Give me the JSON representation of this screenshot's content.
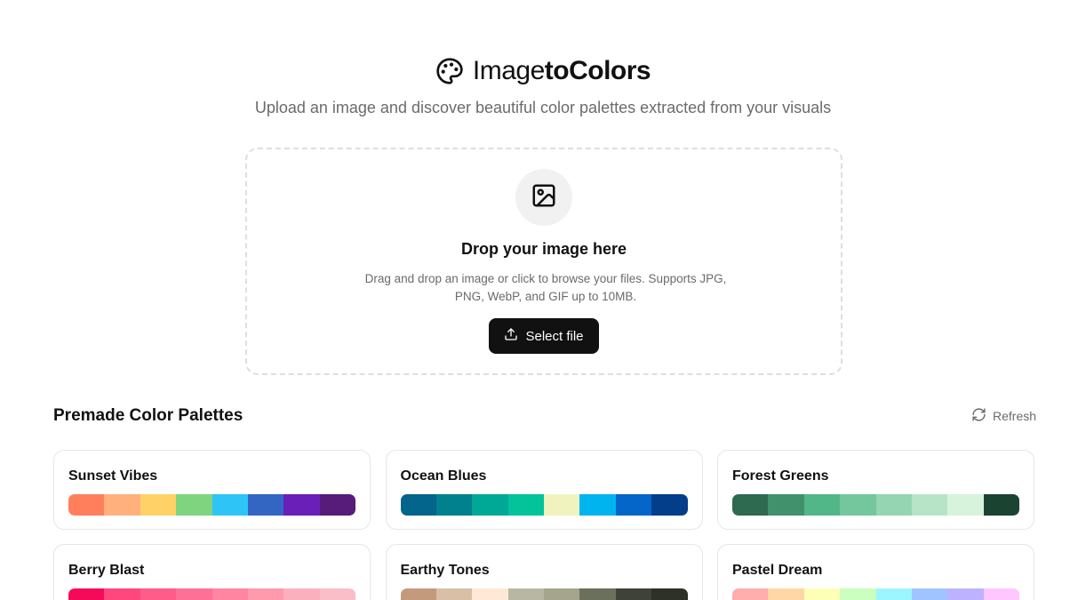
{
  "header": {
    "title_light": "Image",
    "title_bold": "toColors",
    "tagline": "Upload an image and discover beautiful color palettes extracted from your visuals"
  },
  "dropzone": {
    "title": "Drop your image here",
    "description": "Drag and drop an image or click to browse your files. Supports JPG, PNG, WebP, and GIF up to 10MB.",
    "button_label": "Select file"
  },
  "palettes_section": {
    "title": "Premade Color Palettes",
    "refresh_label": "Refresh",
    "palettes": [
      {
        "name": "Sunset Vibes",
        "colors": [
          "#ff7f5c",
          "#ffb07c",
          "#ffd166",
          "#7fd47f",
          "#2ec4f6",
          "#3366c2",
          "#6a1fb8",
          "#571c7a"
        ]
      },
      {
        "name": "Ocean Blues",
        "colors": [
          "#03658c",
          "#01808e",
          "#00a896",
          "#02c39a",
          "#f0f3bd",
          "#00b4f0",
          "#0466c8",
          "#023e8a"
        ]
      },
      {
        "name": "Forest Greens",
        "colors": [
          "#2d6a4f",
          "#40916c",
          "#52b788",
          "#74c69d",
          "#95d5b2",
          "#b7e4c7",
          "#d8f3dc",
          "#1b4332"
        ]
      },
      {
        "name": "Berry Blast",
        "colors": [
          "#f50a5a",
          "#ff477e",
          "#ff5c8a",
          "#ff7096",
          "#ff85a1",
          "#ff99ac",
          "#fbb1bd",
          "#f9bec7"
        ]
      },
      {
        "name": "Earthy Tones",
        "colors": [
          "#c49a7c",
          "#d9bfa6",
          "#ffe8d6",
          "#b7b7a4",
          "#a5a58d",
          "#6b705c",
          "#3f4238",
          "#2d3127"
        ]
      },
      {
        "name": "Pastel Dream",
        "colors": [
          "#ffadad",
          "#ffd6a5",
          "#fdffb6",
          "#caffbf",
          "#9bf6ff",
          "#a0c4ff",
          "#bdb2ff",
          "#ffc6ff"
        ]
      }
    ]
  },
  "icons": {
    "brand": "palette-icon",
    "dropzone": "image-icon",
    "upload": "upload-icon",
    "refresh": "refresh-icon"
  },
  "colors": {
    "primary_button": "#111111",
    "muted_text": "#6b6b6b",
    "border": "#e6e6e6"
  }
}
